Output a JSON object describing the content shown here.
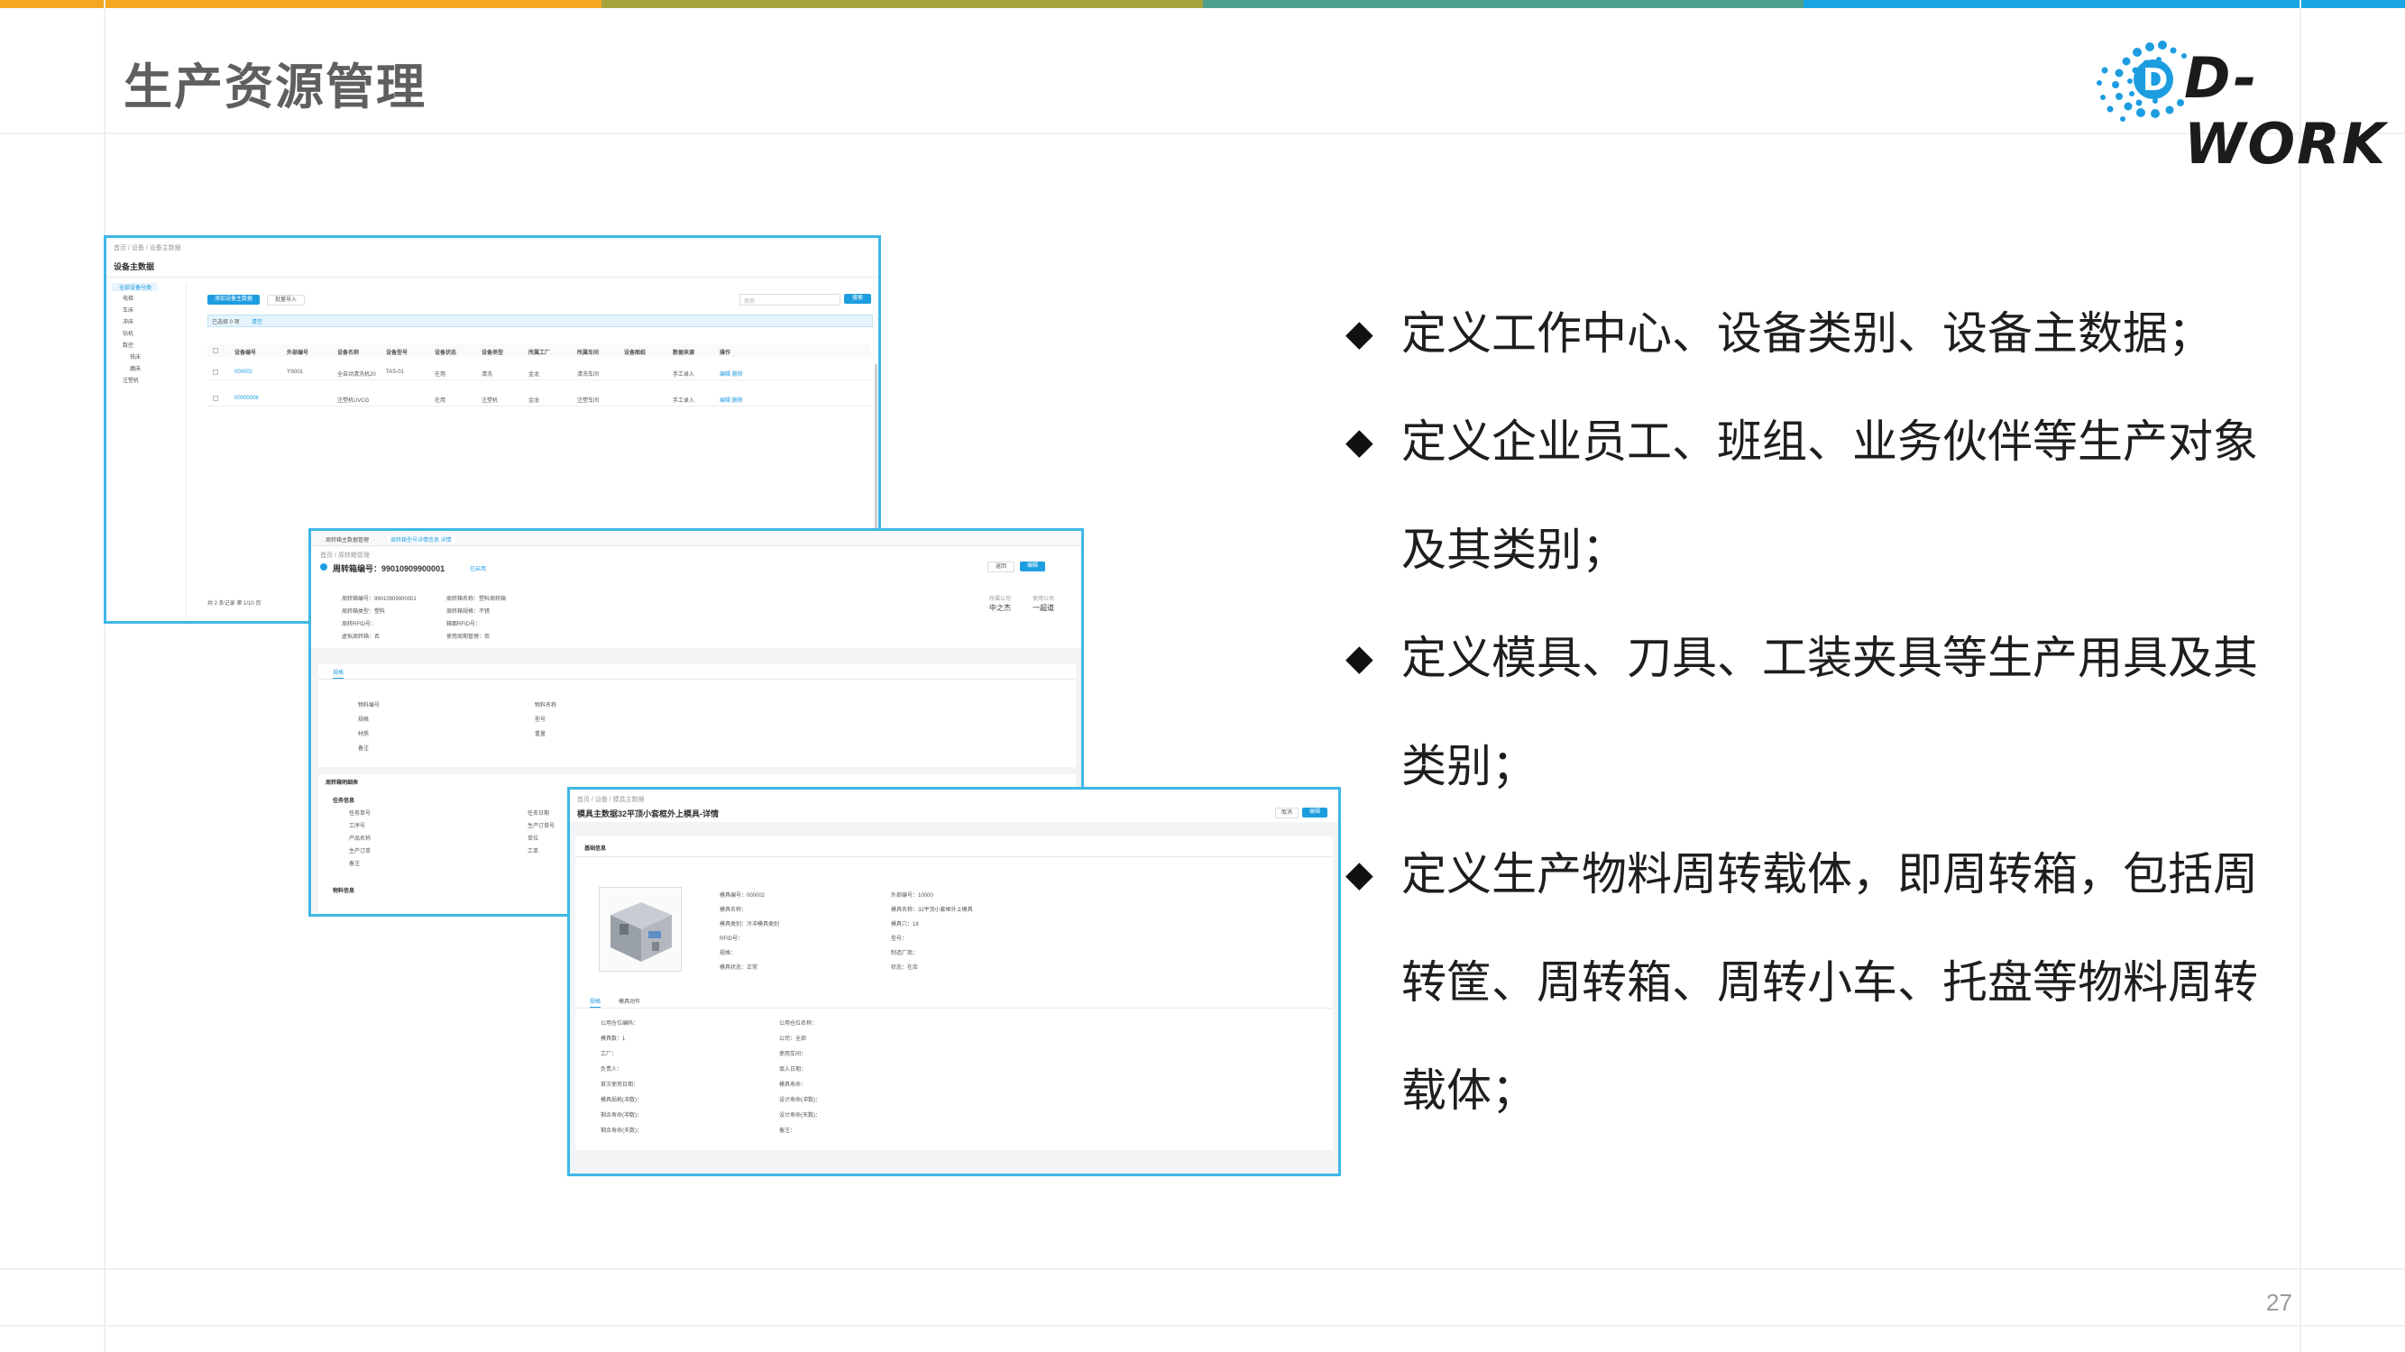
{
  "colors": {
    "topbar": [
      "#f5a623",
      "#a7a33a",
      "#4fa08c",
      "#19a4e4"
    ],
    "accent": "#1d9de0",
    "frame": "#3db8e6"
  },
  "header": {
    "title": "生产资源管理",
    "logo_text": "D-WORK"
  },
  "bullets": [
    "定义工作中心、设备类别、设备主数据；",
    "定义企业员工、班组、业务伙伴等生产对象",
    "及其类别；",
    "定义模具、刀具、工装夹具等生产用具及其",
    "类别；",
    "定义生产物料周转载体，即周转箱，包括周",
    "转筐、周转箱、周转小车、托盘等物料周转",
    "载体；"
  ],
  "bullet_marker": "◆",
  "page_number": "27",
  "screens": {
    "equipment": {
      "breadcrumb": "首页 / 设备 / 设备主数据",
      "title": "设备主数据",
      "tree": [
        "全部设备分类",
        "电梯",
        "车床",
        "冲床",
        "钻机",
        "数控",
        "铣床",
        "磨床",
        "注塑机"
      ],
      "add_button": "添加设备主数据",
      "import_button": "批量导入",
      "search_placeholder": "搜索",
      "search_button": "搜索",
      "selected_info": "已选择 0 项",
      "clear_label": "清空",
      "columns": [
        "设备编号",
        "外部编号",
        "设备名称",
        "设备型号",
        "设备状态",
        "设备类型",
        "所属工厂",
        "所属车间",
        "设备图纸",
        "数据来源",
        "操作"
      ],
      "rows": [
        [
          "000002",
          "YS001",
          "全自动清洗机20",
          "TAS-01",
          "在用",
          "清洗",
          "金龙",
          "清洗车间",
          "",
          "手工录入",
          "编辑  删除"
        ],
        [
          "00000006",
          "",
          "注塑机UVCG",
          "",
          "在用",
          "注塑机",
          "金龙",
          "注塑车间",
          "",
          "手工录入",
          "编辑  删除"
        ]
      ],
      "footer": "共 2 条记录  第 1/10 页"
    },
    "turnover": {
      "tabs": [
        "周转箱主数据管理",
        "周转箱型号详情信息 详情"
      ],
      "breadcrumb": "首页 / 周转箱管理",
      "title": "周转箱编号：99010909900001",
      "status": "已启用",
      "back_button": "返回",
      "edit_button": "编辑",
      "meta": [
        {
          "label": "所属公司",
          "value": "中之杰"
        },
        {
          "label": "使用公司",
          "value": "一超道"
        }
      ],
      "fields_left": [
        "周转箱编号：99010909900001",
        "周转箱类型：塑料",
        "周转RFID号：",
        "虚拟周转箱：否"
      ],
      "fields_right": [
        "周转箱名称：塑料周转箱",
        "周转箱规格：不锈",
        "箱面RFID号：",
        "使用周期管理：否"
      ],
      "section_tab": "规格",
      "spec_left": [
        "物料编号",
        "规格",
        "材质",
        "备注"
      ],
      "spec_right": [
        "物料名称",
        "型号",
        "重量"
      ],
      "list_title": "周转箱明细表",
      "task_title": "任务信息",
      "task_left": [
        "任务单号",
        "工序号",
        "产品名称",
        "生产订单",
        "备注"
      ],
      "task_right": [
        "任务日期",
        "生产订单号",
        "单位",
        "工单"
      ],
      "bottom_title": "物料信息"
    },
    "mold": {
      "breadcrumb": "首页 / 设备 / 模具主数据",
      "title": "模具主数据32平顶小套框外上模具-详情",
      "cancel_button": "取消",
      "edit_button": "编辑",
      "section": "基础信息",
      "info_left": [
        "模具编号：000002",
        "模具名称：",
        "模具类别：冷冲模具类别",
        "RFID号：",
        "规格：",
        "模具状态：正常"
      ],
      "info_right": [
        "外部编号：10000",
        "模具名称：32平顶小套框外上模具",
        "模具穴：18",
        "型号：",
        "制造厂商：",
        "状态：在库"
      ],
      "tabs": [
        "规格",
        "模具动作"
      ],
      "detail_left": [
        "公用仓位编码：",
        "模具数：1",
        "工厂：",
        "负责人：",
        "首次使用日期：",
        "模具损耗(冲数)：",
        "剩余寿命(冲数)：",
        "剩余寿命(天数)："
      ],
      "detail_right": [
        "公用仓位名称：",
        "公司：全部",
        "使用车间：",
        "填入日期：",
        "模具寿命：",
        "设计寿命(冲数)：",
        "设计寿命(天数)：",
        "备注："
      ]
    }
  }
}
